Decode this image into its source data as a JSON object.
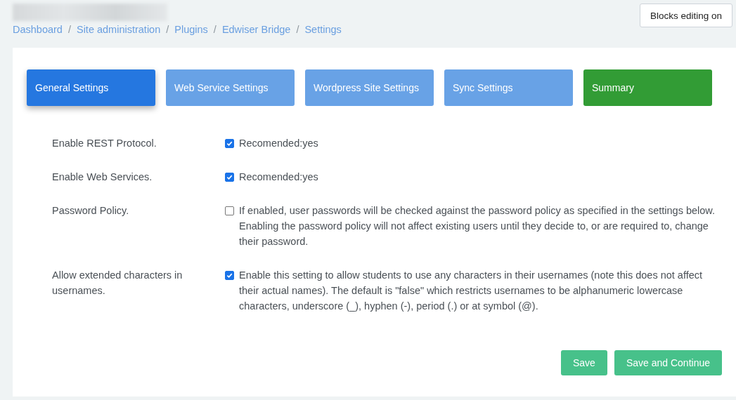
{
  "breadcrumb": [
    "Dashboard",
    "Site administration",
    "Plugins",
    "Edwiser Bridge",
    "Settings"
  ],
  "breadcrumb_separator": "/",
  "header_button": "Blocks editing on",
  "tabs": [
    {
      "label": "General Settings",
      "kind": "step",
      "selected": true
    },
    {
      "label": "Web Service Settings",
      "kind": "step",
      "selected": false
    },
    {
      "label": "Wordpress Site Settings",
      "kind": "step",
      "selected": false
    },
    {
      "label": "Sync Settings",
      "kind": "step",
      "selected": false
    },
    {
      "label": "Summary",
      "kind": "summary",
      "selected": false
    }
  ],
  "settings": [
    {
      "label": "Enable REST Protocol.",
      "checked": true,
      "description": "Recomended:yes"
    },
    {
      "label": "Enable Web Services.",
      "checked": true,
      "description": "Recomended:yes"
    },
    {
      "label": "Password Policy.",
      "checked": false,
      "description": "If enabled, user passwords will be checked against the password policy as specified in the settings below. Enabling the password policy will not affect existing users until they decide to, or are required to, change their password."
    },
    {
      "label": "Allow extended characters in usernames.",
      "checked": true,
      "description": "Enable this setting to allow students to use any characters in their usernames (note this does not affect their actual names). The default is \"false\" which restricts usernames to be alphanumeric lowercase characters, underscore (_), hyphen (-), period (.) or at symbol (@)."
    }
  ],
  "buttons": [
    "Save",
    "Save and Continue"
  ]
}
